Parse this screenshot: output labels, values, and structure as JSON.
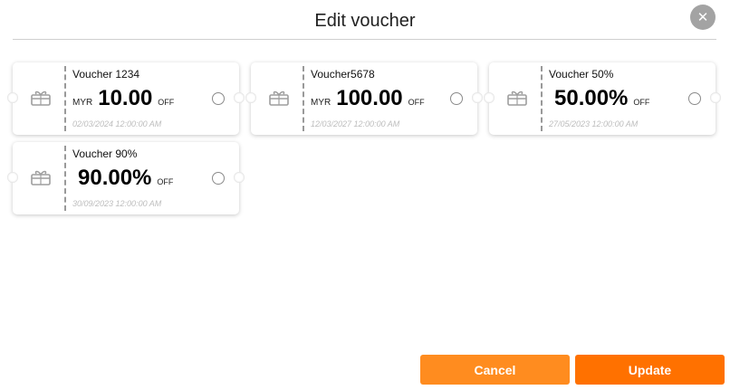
{
  "dialog": {
    "title": "Edit voucher",
    "close_icon": "close-icon",
    "close_glyph": "✕"
  },
  "vouchers": [
    {
      "name": "Voucher 1234",
      "currency": "MYR",
      "amount": "10.00",
      "off": "OFF",
      "date": "02/03/2024 12:00:00 AM",
      "selected": false
    },
    {
      "name": "Voucher5678",
      "currency": "MYR",
      "amount": "100.00",
      "off": "OFF",
      "date": "12/03/2027 12:00:00 AM",
      "selected": false
    },
    {
      "name": "Voucher 50%",
      "currency": "",
      "amount": "50.00%",
      "off": "OFF",
      "date": "27/05/2023 12:00:00 AM",
      "selected": false
    },
    {
      "name": "Voucher 90%",
      "currency": "",
      "amount": "90.00%",
      "off": "OFF",
      "date": "30/09/2023 12:00:00 AM",
      "selected": false
    }
  ],
  "buttons": {
    "cancel_label": "Cancel",
    "update_label": "Update"
  },
  "colors": {
    "cancel": "#ff8c1f",
    "update": "#ff7100",
    "close_bg": "#a3a3a3"
  },
  "icons": {
    "voucher_icon": "gift-icon"
  }
}
